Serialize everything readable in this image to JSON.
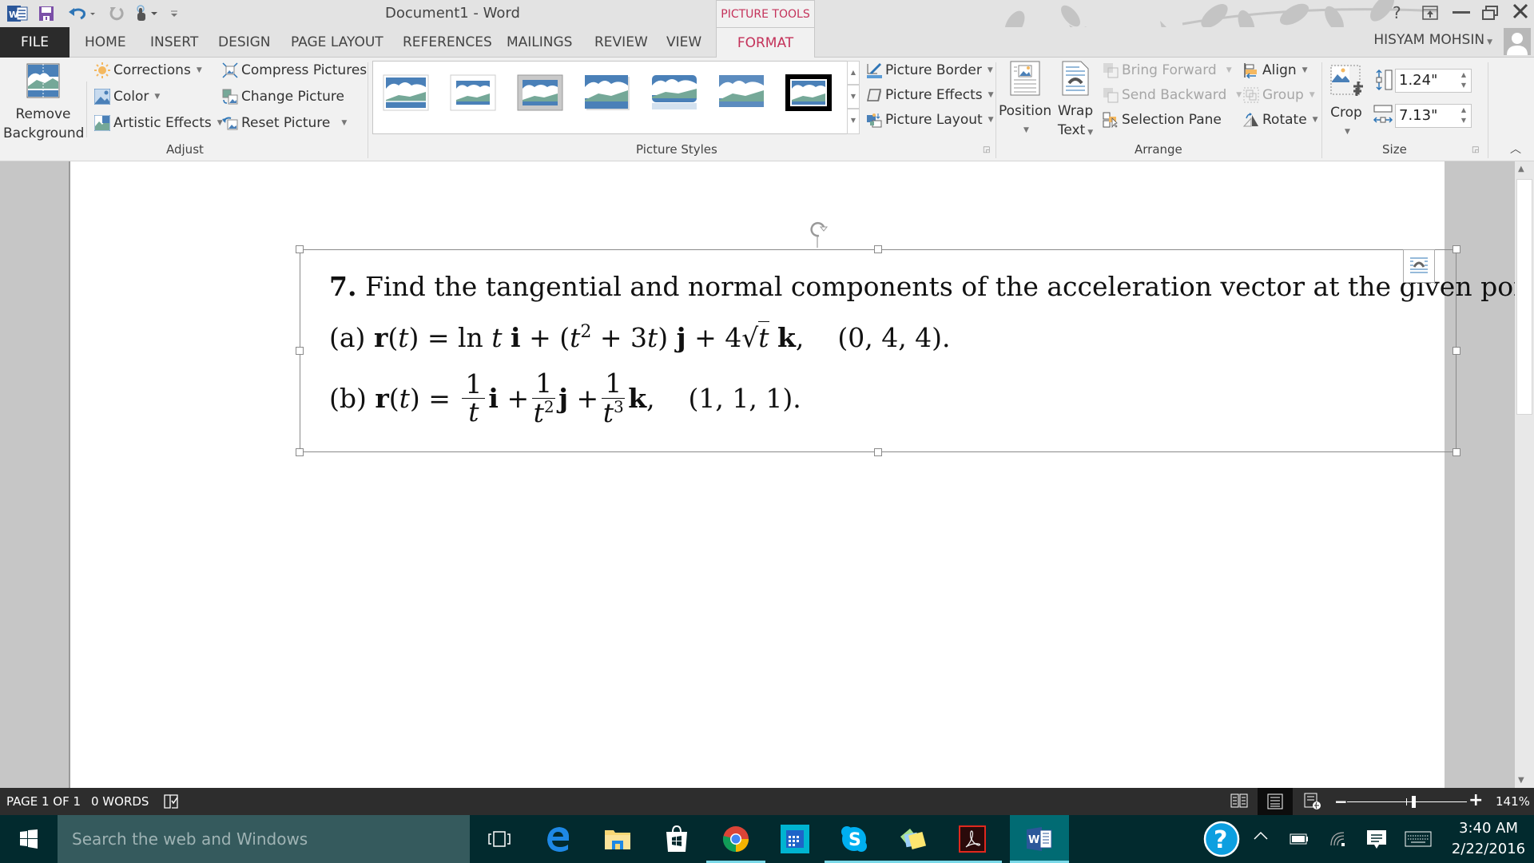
{
  "window": {
    "title": "Document1 - Word",
    "context_tab_group": "PICTURE TOOLS",
    "user_name": "HISYAM MOHSIN",
    "help_label": "?"
  },
  "ribbon_tabs": [
    {
      "label": "FILE"
    },
    {
      "label": "HOME"
    },
    {
      "label": "INSERT"
    },
    {
      "label": "DESIGN"
    },
    {
      "label": "PAGE LAYOUT"
    },
    {
      "label": "REFERENCES"
    },
    {
      "label": "MAILINGS"
    },
    {
      "label": "REVIEW"
    },
    {
      "label": "VIEW"
    },
    {
      "label": "FORMAT",
      "active": true
    }
  ],
  "ribbon": {
    "adjust": {
      "group_label": "Adjust",
      "remove_background": [
        "Remove",
        "Background"
      ],
      "corrections": "Corrections",
      "color": "Color",
      "artistic_effects": "Artistic Effects",
      "compress_pictures": "Compress Pictures",
      "change_picture": "Change Picture",
      "reset_picture": "Reset Picture"
    },
    "picture_styles": {
      "group_label": "Picture Styles",
      "picture_border": "Picture Border",
      "picture_effects": "Picture Effects",
      "picture_layout": "Picture Layout",
      "gallery_count": 7
    },
    "arrange": {
      "group_label": "Arrange",
      "position": "Position",
      "wrap_text": [
        "Wrap",
        "Text"
      ],
      "bring_forward": "Bring Forward",
      "send_backward": "Send Backward",
      "selection_pane": "Selection Pane",
      "align": "Align",
      "group": "Group",
      "rotate": "Rotate"
    },
    "size": {
      "group_label": "Size",
      "crop": "Crop",
      "height": "1.24\"",
      "width": "7.13\""
    }
  },
  "document": {
    "problem_number": "7.",
    "problem_text": "Find the tangential and normal components of the acceleration vector at the given point.",
    "part_a": {
      "label": "(a)",
      "lhs": "r(t) =",
      "term1": "ln t i + (t",
      "term1_sup": "2",
      "term1_rest": " + 3t) j + 4",
      "sqrt_arg": "t",
      "term_k": "k,",
      "point": "(0, 4, 4)."
    },
    "part_b": {
      "label": "(b)",
      "lhs": "r(t) =",
      "fracs": [
        {
          "num": "1",
          "den": "t",
          "den_sup": "",
          "unit": "i +"
        },
        {
          "num": "1",
          "den": "t",
          "den_sup": "2",
          "unit": "j +"
        },
        {
          "num": "1",
          "den": "t",
          "den_sup": "3",
          "unit": "k,"
        }
      ],
      "point": "(1, 1, 1)."
    }
  },
  "status_bar": {
    "page": "PAGE 1 OF 1",
    "words": "0 WORDS",
    "zoom_minus": "−",
    "zoom_plus": "+",
    "zoom_level": "141%",
    "zoom_percent": 141
  },
  "taskbar": {
    "search_placeholder": "Search the web and Windows",
    "time": "3:40 AM",
    "date": "2/22/2016",
    "apps": [
      "task-view",
      "edge",
      "file-explorer",
      "store",
      "chrome",
      "calendar",
      "skype",
      "sticky-notes",
      "acrobat",
      "word"
    ]
  }
}
